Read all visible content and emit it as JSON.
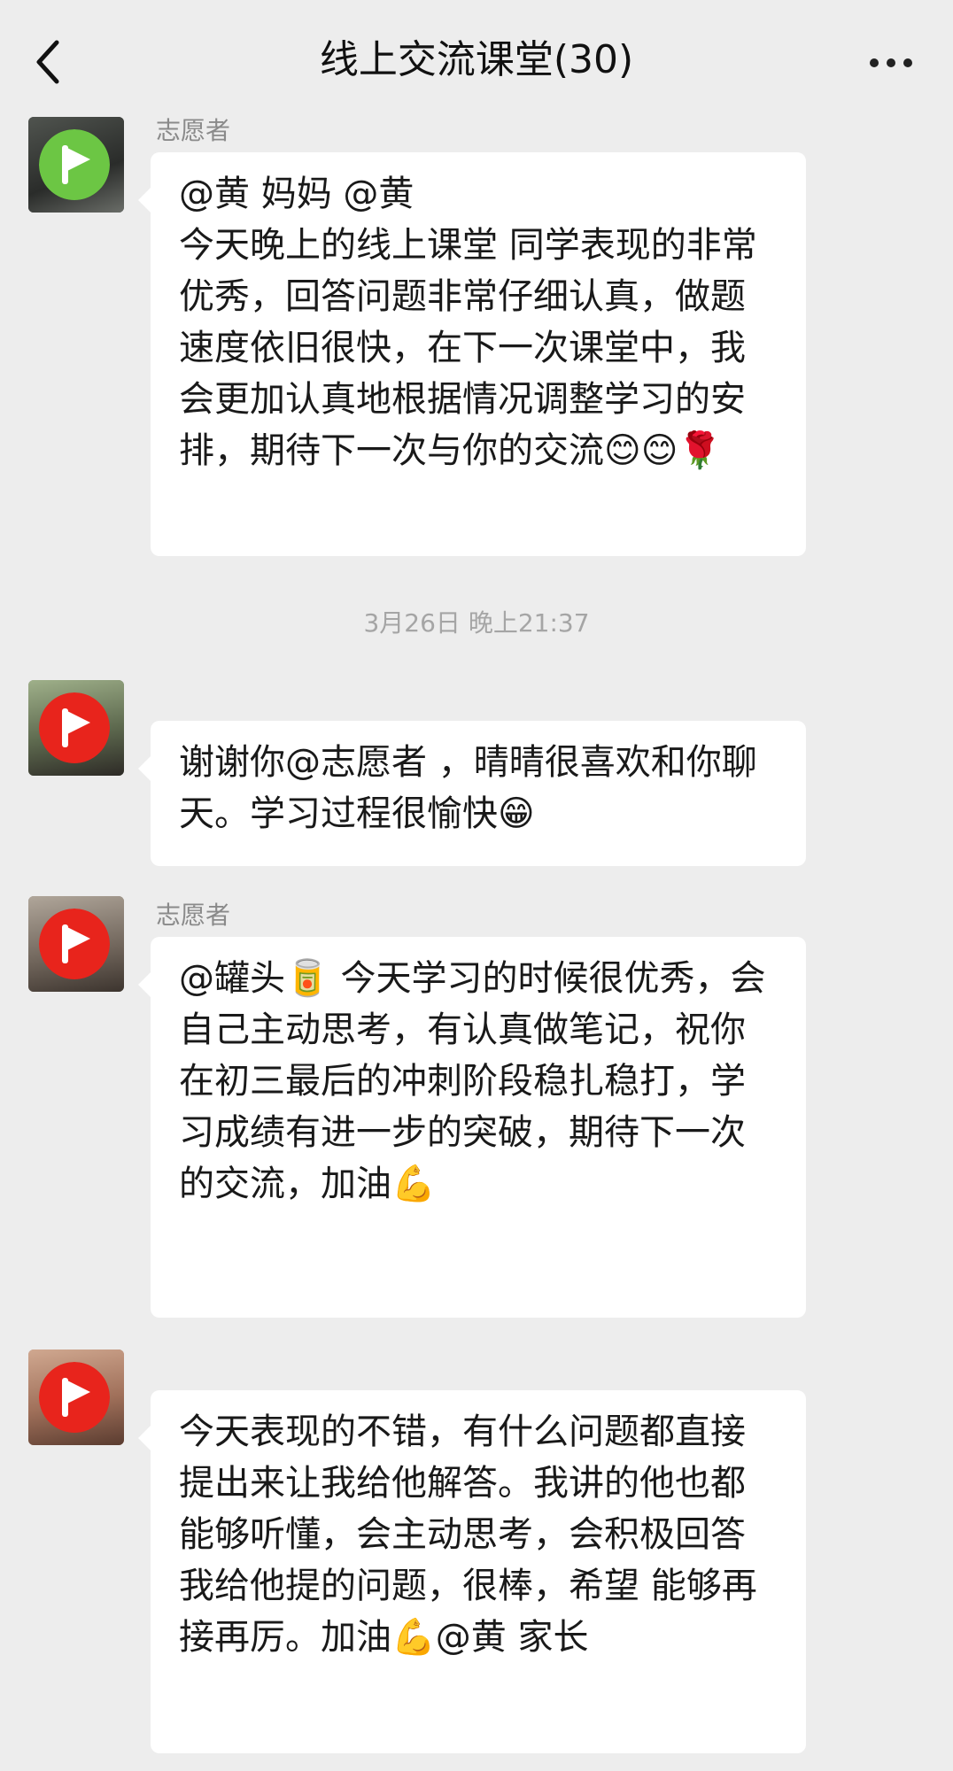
{
  "header": {
    "title": "线上交流课堂(30)",
    "back_icon": "back-chevron-icon",
    "more_icon": "more-dots-icon"
  },
  "colors": {
    "background": "#ededed",
    "bubble": "#ffffff",
    "badge_green": "#6cc644",
    "badge_red": "#e8241c"
  },
  "messages": [
    {
      "sender": "志愿者",
      "text": "@黄 妈妈 @黄 \n今天晚上的线上课堂 同学表现的非常优秀，回答问题非常仔细认真，做题速度依旧很快，在下一次课堂中，我会更加认真地根据情况调整学习的安排，期待下一次与你的交流😊😊🌹",
      "badge_icon": "play-flag-icon"
    },
    {
      "sender": "",
      "text": "谢谢你@志愿者 ，晴晴很喜欢和你聊天。学习过程很愉快😁",
      "badge_icon": "play-flag-icon"
    },
    {
      "sender": "志愿者",
      "text": "@罐头🥫 今天学习的时候很优秀，会自己主动思考，有认真做笔记，祝你在初三最后的冲刺阶段稳扎稳打，学习成绩有进一步的突破，期待下一次的交流，加油💪",
      "badge_icon": "play-flag-icon"
    },
    {
      "sender": "",
      "text": "今天表现的不错，有什么问题都直接提出来让我给他解答。我讲的他也都能够听懂，会主动思考，会积极回答我给他提的问题，很棒，希望 能够再接再厉。加油💪@黄 家长",
      "badge_icon": "play-flag-icon"
    }
  ],
  "timestamp": "3月26日 晚上21:37"
}
